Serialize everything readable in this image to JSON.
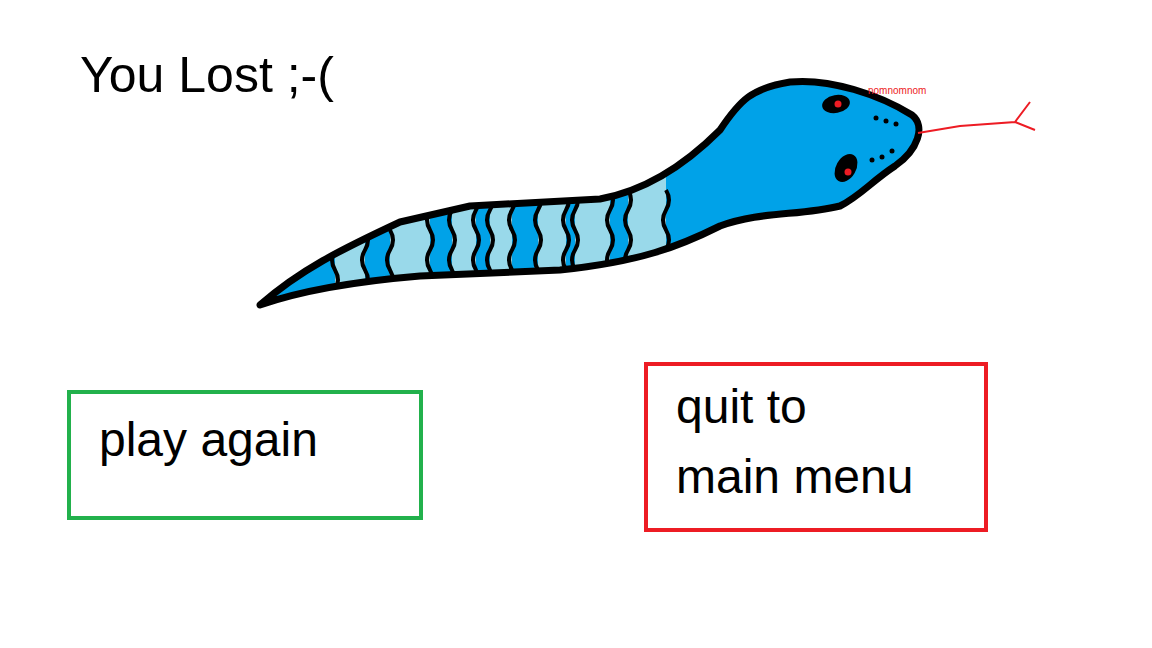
{
  "screen": {
    "title": "You Lost ;-("
  },
  "snake": {
    "caption": "nomnomnom"
  },
  "buttons": [
    {
      "label": "play again",
      "color": "#22b14c"
    },
    {
      "label": "quit to main menu",
      "color": "#ed1c24"
    }
  ]
}
